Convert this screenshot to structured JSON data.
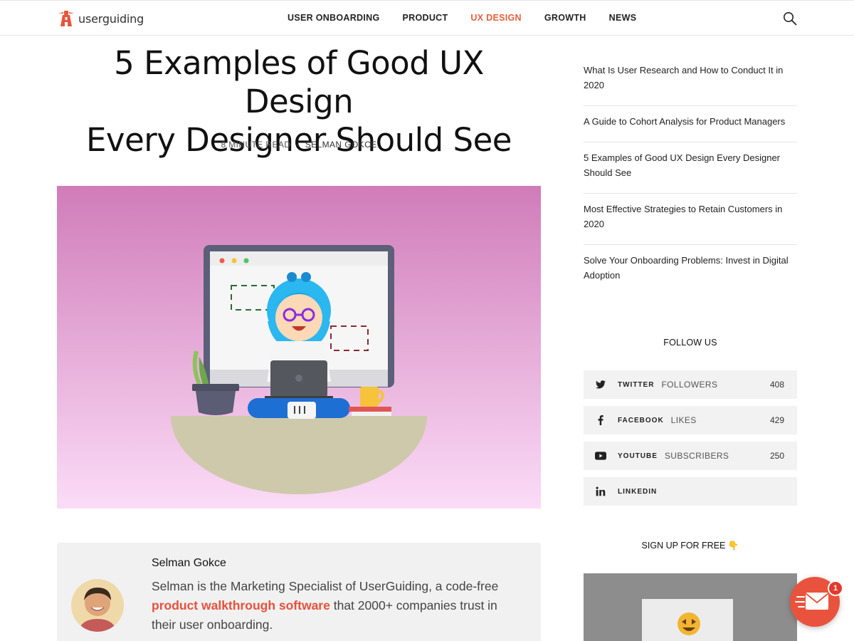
{
  "header": {
    "logo_text": "userguiding",
    "nav": [
      {
        "label": "USER ONBOARDING",
        "active": false
      },
      {
        "label": "PRODUCT",
        "active": false
      },
      {
        "label": "UX DESIGN",
        "active": true
      },
      {
        "label": "GROWTH",
        "active": false
      },
      {
        "label": "NEWS",
        "active": false
      }
    ],
    "search_icon": "search-icon"
  },
  "article": {
    "title_line1": "5 Examples of Good UX Design",
    "title_line2": "Every Designer Should See",
    "read_time": "8 MINUTE READ",
    "separator": "·",
    "author": "SELMAN GOKCE"
  },
  "author_box": {
    "name": "Selman Gokce",
    "bio_before": "Selman is the Marketing Specialist of UserGuiding, a code-free ",
    "bio_link": "product walkthrough software",
    "bio_after": " that 2000+ companies trust in their user onboarding."
  },
  "sidebar": {
    "related": [
      "What Is User Research and How to Conduct It in 2020",
      "A Guide to Cohort Analysis for Product Managers",
      "5 Examples of Good UX Design Every Designer Should See",
      "Most Effective Strategies to Retain Customers in 2020",
      "Solve Your Onboarding Problems: Invest in Digital Adoption"
    ],
    "follow_title": "FOLLOW US",
    "social": [
      {
        "icon": "twitter-icon",
        "name": "TWITTER",
        "label": "FOLLOWERS",
        "count": "408"
      },
      {
        "icon": "facebook-icon",
        "name": "FACEBOOK",
        "label": "LIKES",
        "count": "429"
      },
      {
        "icon": "youtube-icon",
        "name": "YOUTUBE",
        "label": "SUBSCRIBERS",
        "count": "250"
      },
      {
        "icon": "linkedin-icon",
        "name": "LINKEDIN",
        "label": "",
        "count": ""
      }
    ],
    "signup_title": "SIGN UP FOR FREE",
    "signup_emoji": "👇"
  },
  "chat": {
    "badge_count": "1"
  },
  "colors": {
    "accent": "#e85f3d",
    "hero_top": "#d07cb9",
    "hero_bottom": "#fbdcf7",
    "sidebar_tile": "#f2f2f2"
  }
}
